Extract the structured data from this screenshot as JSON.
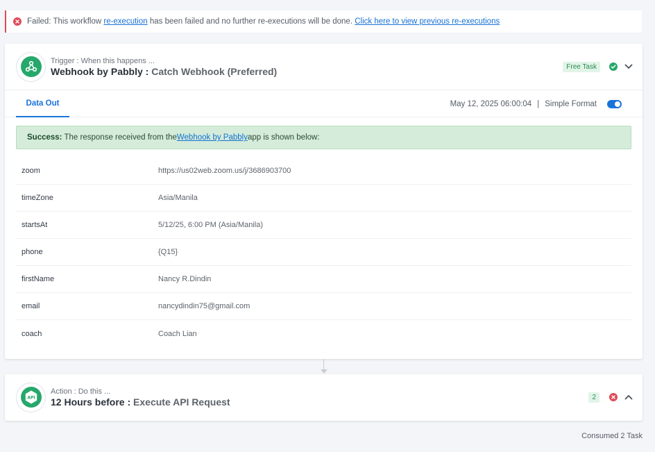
{
  "alert": {
    "prefix": "Failed: This workflow ",
    "link1": "re-execution",
    "middle": " has been failed and no further re-executions will be done. ",
    "link2": "Click here to view previous re-executions"
  },
  "trigger": {
    "subtitle": "Trigger : When this happens ...",
    "app_name": "Webhook by Pabbly : ",
    "event_name": "Catch Webhook (Preferred)",
    "badge": "Free Task",
    "tab_label": "Data Out",
    "timestamp": "May 12, 2025 06:00:04",
    "separator": "|",
    "format_label": "Simple Format",
    "success": {
      "bold": "Success:",
      "text1": " The response received from the ",
      "link": "Webhook by Pabbly",
      "text2": " app is shown below:"
    },
    "fields": [
      {
        "key": "zoom",
        "value": "https://us02web.zoom.us/j/3686903700"
      },
      {
        "key": "timeZone",
        "value": "Asia/Manila"
      },
      {
        "key": "startsAt",
        "value": "5/12/25, 6:00 PM (Asia/Manila)"
      },
      {
        "key": "phone",
        "value": "{Q15}"
      },
      {
        "key": "firstName",
        "value": "Nancy R.Dindin"
      },
      {
        "key": "email",
        "value": "nancydindin75@gmail.com"
      },
      {
        "key": "coach",
        "value": "Coach Lian"
      }
    ]
  },
  "action": {
    "subtitle": "Action : Do this ...",
    "app_name": "12 Hours before : ",
    "event_name": "Execute API Request",
    "badge": "2",
    "icon_text": "API"
  },
  "footer": {
    "consumed": "Consumed 2 Task"
  },
  "colors": {
    "accent": "#1a73d9",
    "success": "#26a86b",
    "error": "#e04a59"
  }
}
